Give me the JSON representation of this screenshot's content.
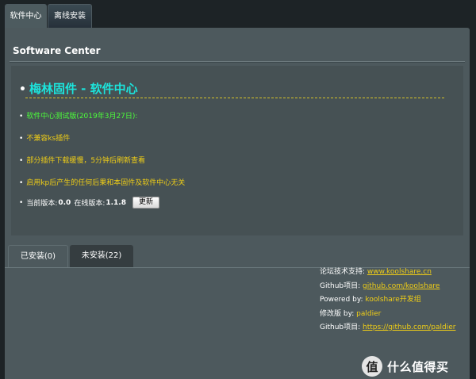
{
  "top_tabs": [
    {
      "label": "软件中心",
      "active": true
    },
    {
      "label": "离线安装",
      "active": false
    }
  ],
  "panel": {
    "title": "Software Center",
    "heading": "梅林固件 - 软件中心",
    "notes": [
      {
        "text": "软件中心测试版(2019年3月27日):",
        "color": "#4cff3a"
      },
      {
        "text": "不兼容ks插件",
        "color": "#f0ce16"
      },
      {
        "text": "部分插件下载缓慢，5分钟后刷新查看",
        "color": "#f0ce16"
      },
      {
        "text": "启用kp后产生的任何后果和本固件及软件中心无关",
        "color": "#f0ce16"
      }
    ],
    "version": {
      "current_label": "当前版本:",
      "current_value": "0.0",
      "online_label": "在线版本:",
      "online_value": "1.1.8",
      "update_button": "更新"
    }
  },
  "bottom_tabs": [
    {
      "label": "已安装(0)",
      "active": true
    },
    {
      "label": "未安装(22)",
      "active": false
    }
  ],
  "footer": {
    "forum_label": "论坛技术支持:",
    "forum_link": "www.koolshare.cn",
    "github1_label": "Github项目:",
    "github1_link": "github.com/koolshare",
    "powered_label": "Powered by:",
    "powered_value": "koolshare开发组",
    "modified_label": "修改版 by:",
    "modified_value": "paldier",
    "github2_label": "Github项目:",
    "github2_link": "https://github.com/paldier"
  },
  "watermark": {
    "badge": "值",
    "text": "什么值得买"
  },
  "colors": {
    "accent_cyan": "#1ce4dc",
    "green": "#4cff3a",
    "yellow": "#f0ce16",
    "panel": "#4d595d"
  }
}
